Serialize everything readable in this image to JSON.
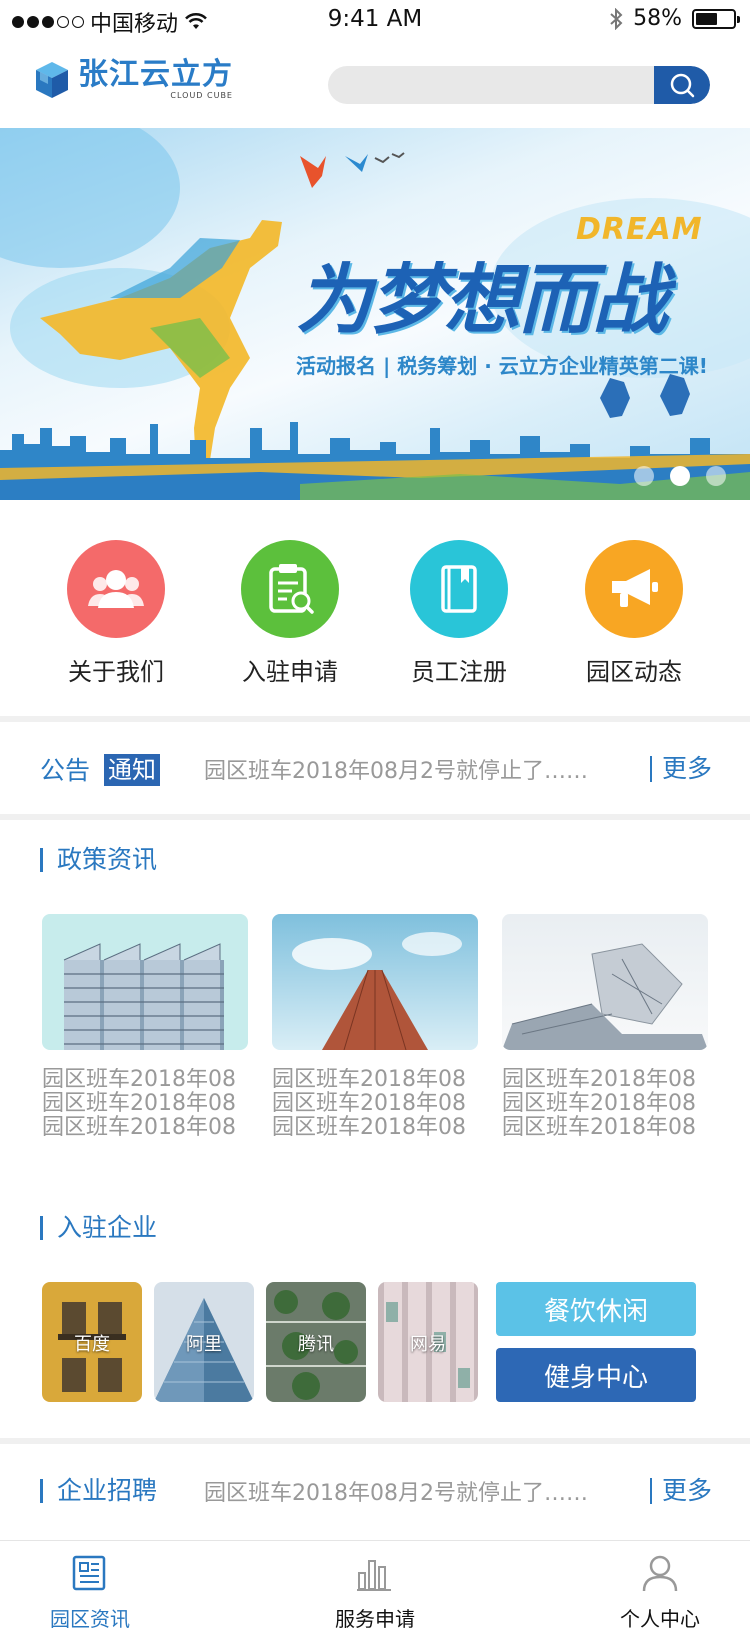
{
  "status_bar": {
    "carrier": "中国移动",
    "time": "9:41 AM",
    "battery": "58%",
    "battery_level": 0.58
  },
  "header": {
    "logo_main": "张江云立方",
    "logo_sub": "CLOUD CUBE",
    "search_placeholder": "",
    "search_icon": "search-icon"
  },
  "banner": {
    "dream": "DREAM",
    "slogan": "为梦想而战",
    "tagline": "活动报名 | 税务筹划 · 云立方企业精英第二课!",
    "active_slide": 2,
    "slide_count": 3
  },
  "quick_menu": [
    {
      "label": "关于我们",
      "icon": "users-icon",
      "color": "#f46a6a"
    },
    {
      "label": "入驻申请",
      "icon": "clipboard-search-icon",
      "color": "#5cc03c"
    },
    {
      "label": "员工注册",
      "icon": "book-icon",
      "color": "#29c5d8"
    },
    {
      "label": "园区动态",
      "icon": "megaphone-icon",
      "color": "#f8a623"
    }
  ],
  "notice": {
    "label": "公告",
    "badge": "通知",
    "text": "园区班车2018年08月2号就停止了……",
    "more": "更多"
  },
  "policy": {
    "title": "政策资讯",
    "cards": [
      {
        "lines": [
          "园区班车2018年08",
          "园区班车2018年08",
          "园区班车2018年08"
        ]
      },
      {
        "lines": [
          "园区班车2018年08",
          "园区班车2018年08",
          "园区班车2018年08"
        ]
      },
      {
        "lines": [
          "园区班车2018年08",
          "园区班车2018年08",
          "园区班车2018年08"
        ]
      }
    ]
  },
  "companies": {
    "title": "入驻企业",
    "items": [
      "百度",
      "阿里",
      "腾讯",
      "网易"
    ],
    "buttons": [
      {
        "label": "餐饮休闲",
        "color": "#5bc2e7"
      },
      {
        "label": "健身中心",
        "color": "#2d68b5"
      }
    ]
  },
  "recruit": {
    "title": "企业招聘",
    "text": "园区班车2018年08月2号就停止了……",
    "more": "更多"
  },
  "tabbar": [
    {
      "label": "园区资讯",
      "icon": "news-icon",
      "active": true
    },
    {
      "label": "服务申请",
      "icon": "bar-chart-icon",
      "active": false
    },
    {
      "label": "个人中心",
      "icon": "user-icon",
      "active": false
    }
  ],
  "colors": {
    "primary": "#2a78c0",
    "dark_blue": "#1f5ba8",
    "muted_text": "#999999"
  }
}
